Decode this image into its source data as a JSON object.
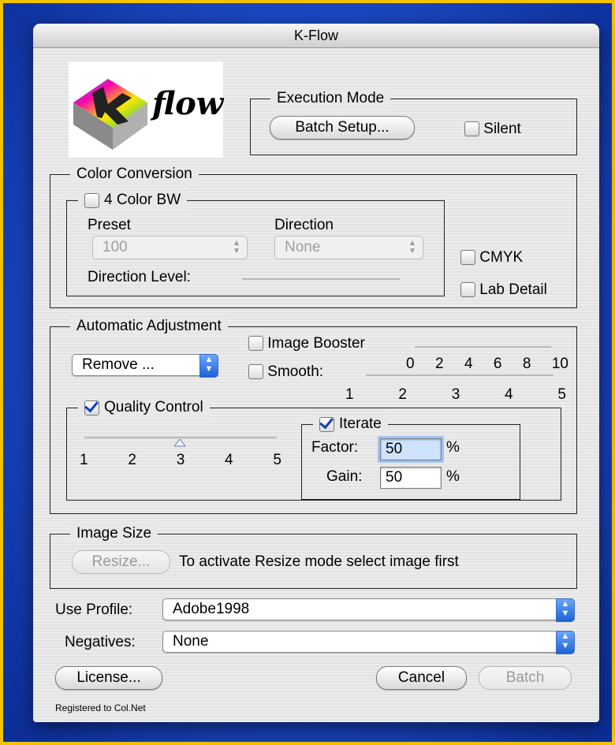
{
  "window": {
    "title": "K-Flow"
  },
  "logo": {
    "text": "flow",
    "letter": "K"
  },
  "execution_mode": {
    "legend": "Execution Mode",
    "batch_setup_label": "Batch Setup...",
    "silent_label": "Silent",
    "silent_checked": false
  },
  "color_conversion": {
    "legend": "Color Conversion",
    "four_color_bw_label": "4 Color BW",
    "four_color_bw_checked": false,
    "preset_label": "Preset",
    "preset_value": "100",
    "direction_label": "Direction",
    "direction_value": "None",
    "direction_level_label": "Direction Level:",
    "cmyk_label": "CMYK",
    "cmyk_checked": false,
    "lab_detail_label": "Lab Detail",
    "lab_detail_checked": false
  },
  "automatic_adjustment": {
    "legend": "Automatic Adjustment",
    "mode_value": "Remove ...",
    "image_booster_label": "Image Booster",
    "smooth_label": "Smooth:",
    "smooth_scale": [
      "0",
      "2",
      "4",
      "6",
      "8",
      "10"
    ],
    "scale_1_5": [
      "1",
      "2",
      "3",
      "4",
      "5"
    ],
    "quality_control_label": "Quality Control",
    "quality_control_checked": true,
    "quality_scale": [
      "1",
      "2",
      "3",
      "4",
      "5"
    ],
    "quality_value": 3,
    "iterate_label": "Iterate",
    "iterate_checked": true,
    "factor_label": "Factor:",
    "factor_value": "50",
    "gain_label": "Gain:",
    "gain_value": "50",
    "percent": "%"
  },
  "image_size": {
    "legend": "Image Size",
    "resize_label": "Resize...",
    "hint": "To activate Resize mode select image first"
  },
  "profile": {
    "label": "Use Profile:",
    "value": "Adobe1998"
  },
  "negatives": {
    "label": "Negatives:",
    "value": "None"
  },
  "buttons": {
    "license": "License...",
    "cancel": "Cancel",
    "batch": "Batch"
  },
  "footer": {
    "registered": "Registered to Col.Net"
  },
  "colors": {
    "accent_blue": "#1d61d6",
    "background_blue": "#1f4fcc",
    "frame_yellow": "#f2c300"
  }
}
